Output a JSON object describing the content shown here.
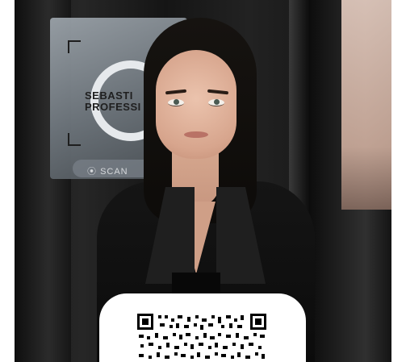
{
  "image": {
    "sign": {
      "line1": "SEBASTI",
      "line2": "PROFESSI",
      "scan_label": "SCAN"
    },
    "qr": {
      "icon": "qr-code-icon"
    }
  }
}
